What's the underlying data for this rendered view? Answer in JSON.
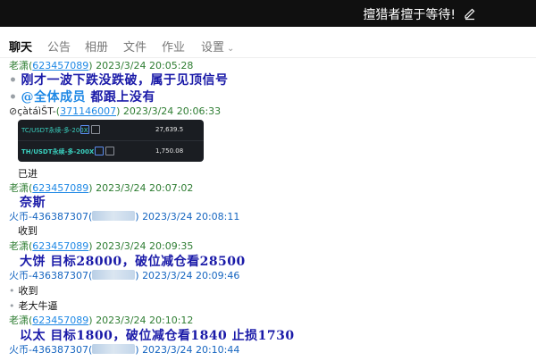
{
  "window": {
    "title": "擅猎者擅于等待!"
  },
  "tabs": [
    {
      "label": "聊天"
    },
    {
      "label": "公告"
    },
    {
      "label": "相册"
    },
    {
      "label": "文件"
    },
    {
      "label": "作业"
    },
    {
      "label": "设置"
    }
  ],
  "messages": {
    "m1": {
      "sender": "老潇",
      "qq": "623457089",
      "time": "2023/3/24 20:05:28"
    },
    "t1": "刚才一波下跌没跌破，属于见顶信号",
    "t2_at": "@全体成员",
    "t2_rest": "都跟上没有",
    "m2": {
      "sender": "⊘çàtáìŠT-",
      "qq": "371146007",
      "time": "2023/3/24 20:06:33"
    },
    "img": {
      "row1_sym": "TC/USDT永续-多-200X",
      "row1_val": "27,639.5",
      "row2_sym": "TH/USDT永续-多-200X",
      "row2_val": "1,750.08"
    },
    "t3": "已进",
    "m3": {
      "sender": "老潇",
      "qq": "623457089",
      "time": "2023/3/24 20:07:02"
    },
    "t4": "奈斯",
    "m4": {
      "sender": "火币-436387307",
      "time": "2023/3/24 20:08:11"
    },
    "t5": "收到",
    "m5": {
      "sender": "老潇",
      "qq": "623457089",
      "time": "2023/3/24 20:09:35"
    },
    "t6": "大饼   目标28000，破位减仓看28500",
    "m6": {
      "sender": "火币-436387307",
      "time": "2023/3/24 20:09:46"
    },
    "t7": "收到",
    "t8": "老大牛逼",
    "m7": {
      "sender": "老潇",
      "qq": "623457089",
      "time": "2023/3/24 20:10:12"
    },
    "t9": "以太  目标1800，破位减仓看1840  止损1730",
    "m8": {
      "sender": "火币-436387307",
      "time": "2023/3/24 20:10:44"
    }
  },
  "colors": {
    "titlebar": "#101010",
    "accent_green": "#2e7d32",
    "link_blue": "#1e88e5",
    "big_text": "#1a1aa8"
  }
}
